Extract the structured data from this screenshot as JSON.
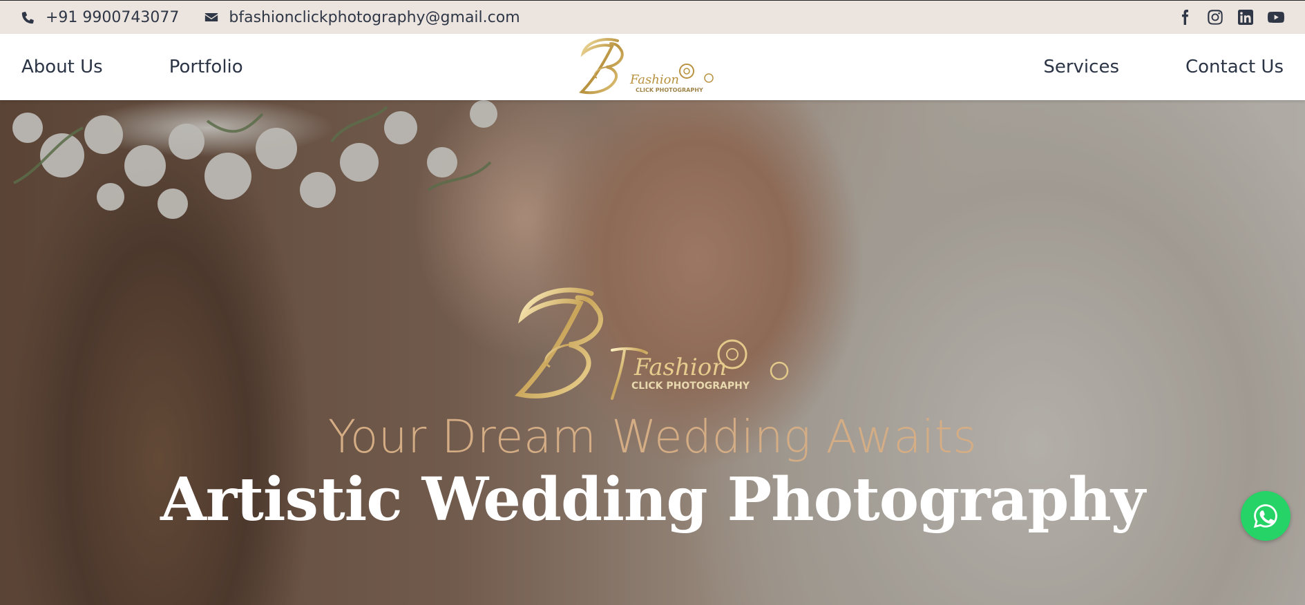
{
  "topbar": {
    "phone": "+91 9900743077",
    "email": "bfashionclickphotography@gmail.com",
    "social": [
      "facebook-icon",
      "instagram-icon",
      "linkedin-icon",
      "youtube-icon"
    ]
  },
  "nav": {
    "left": [
      "About Us",
      "Portfolio"
    ],
    "right": [
      "Services",
      "Contact Us"
    ]
  },
  "brand": {
    "logo_letter": "B",
    "logo_script": "Fashion",
    "logo_sub": "CLICK PHOTOGRAPHY"
  },
  "hero": {
    "tagline": "Your Dream Wedding Awaits",
    "headline": "Artistic Wedding Photography"
  },
  "colors": {
    "topbar_bg": "#ece4de",
    "text_dark": "#2b3445",
    "tagline": "#d5ad85",
    "gold": "#c8a96a",
    "whatsapp": "#25d366"
  },
  "icons": {
    "phone": "phone-icon",
    "email": "envelope-icon",
    "chat": "whatsapp-icon"
  }
}
